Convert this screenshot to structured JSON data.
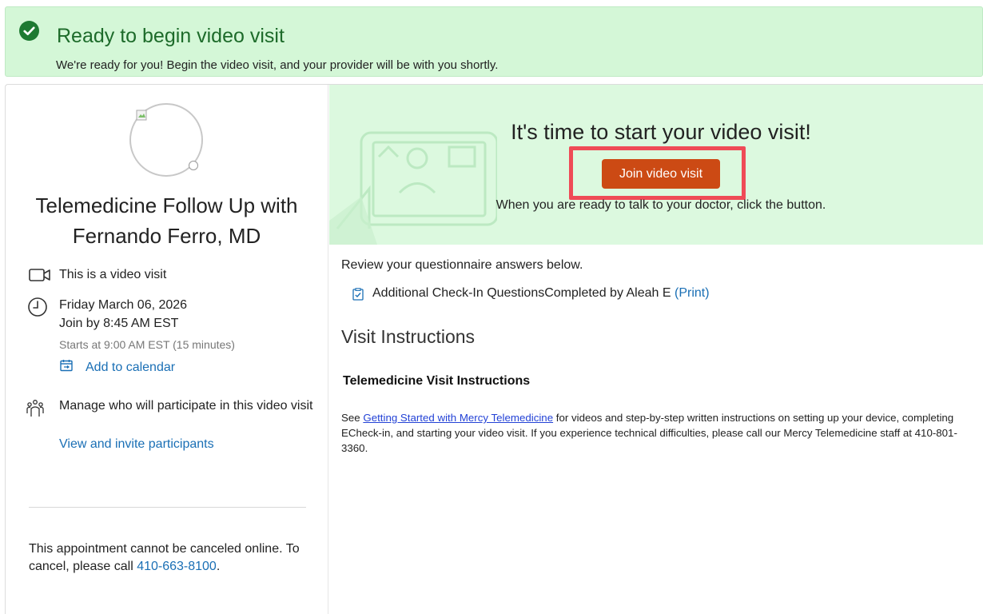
{
  "banner": {
    "title": "Ready to begin video visit",
    "text": "We're ready for you! Begin the video visit, and your provider will be with you shortly.",
    "icon": "check-circle-icon",
    "color": "#1d6b2a"
  },
  "visit": {
    "title": "Telemedicine Follow Up with Fernando Ferro, MD",
    "video_label": "This is a video visit",
    "date": "Friday March 06, 2026",
    "join_by": "Join by 8:45 AM EST",
    "starts": "Starts at 9:00 AM EST (15 minutes)",
    "add_calendar": "Add to calendar",
    "manage_participants": "Manage who will participate in this video visit",
    "view_participants": "View and invite participants",
    "cancel_text": "This appointment cannot be canceled online. To cancel, please call ",
    "cancel_phone": "410-663-8100",
    "cancel_end": "."
  },
  "hero": {
    "title": "It's time to start your video visit!",
    "join_button": "Join video visit",
    "subtitle": "When you are ready to talk to your doctor, click the button.",
    "button_color": "#cc4a14",
    "highlight_color": "#ef4b56"
  },
  "questionnaire": {
    "review": "Review your questionnaire answers below.",
    "item": "Additional Check-In QuestionsCompleted by Aleah E",
    "print": "(Print)"
  },
  "instructions": {
    "heading": "Visit Instructions",
    "subheading": "Telemedicine Visit Instructions",
    "see": "See ",
    "link": "Getting Started with Mercy Telemedicine",
    "body": " for videos and step-by-step written instructions on setting up your device, completing ECheck-in, and starting your video visit. If you experience technical difficulties, please call our Mercy Telemedicine staff at 410-801-3360."
  }
}
